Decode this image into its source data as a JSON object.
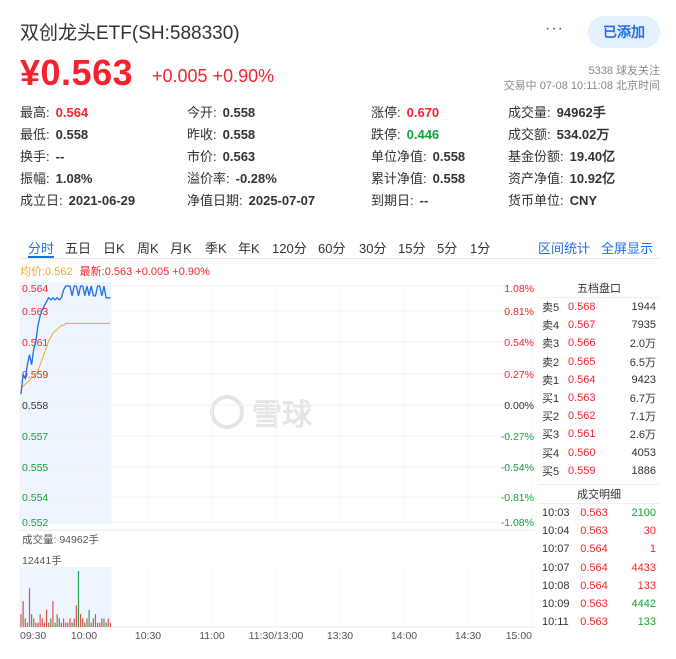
{
  "header": {
    "title": "双创龙头ETF(SH:588330)",
    "more_label": "···",
    "add_label": "已添加",
    "price": "¥0.563",
    "change": "+0.005 +0.90%",
    "followers": "5338 球友关注",
    "status": "交易中 07-08 10:11:08 北京时间"
  },
  "stats": [
    [
      {
        "label": "最高:",
        "value": "0.564",
        "color": "red"
      },
      {
        "label": "今开:",
        "value": "0.558"
      },
      {
        "label": "涨停:",
        "value": "0.670",
        "color": "red"
      },
      {
        "label": "成交量:",
        "value": "94962手"
      }
    ],
    [
      {
        "label": "最低:",
        "value": "0.558"
      },
      {
        "label": "昨收:",
        "value": "0.558"
      },
      {
        "label": "跌停:",
        "value": "0.446",
        "color": "green"
      },
      {
        "label": "成交额:",
        "value": "534.02万"
      }
    ],
    [
      {
        "label": "换手:",
        "value": "--"
      },
      {
        "label": "市价:",
        "value": "0.563"
      },
      {
        "label": "单位净值:",
        "value": "0.558"
      },
      {
        "label": "基金份额:",
        "value": "19.40亿"
      }
    ],
    [
      {
        "label": "振幅:",
        "value": "1.08%"
      },
      {
        "label": "溢价率:",
        "value": "-0.28%"
      },
      {
        "label": "累计净值:",
        "value": "0.558"
      },
      {
        "label": "资产净值:",
        "value": "10.92亿"
      }
    ],
    [
      {
        "label": "成立日:",
        "value": "2021-06-29"
      },
      {
        "label": "净值日期:",
        "value": "2025-07-07"
      },
      {
        "label": "到期日:",
        "value": "--"
      },
      {
        "label": "货币单位:",
        "value": "CNY"
      }
    ]
  ],
  "tabs": [
    "分时",
    "五日",
    "日K",
    "周K",
    "月K",
    "季K",
    "年K",
    "120分",
    "60分",
    "30分",
    "15分",
    "5分",
    "1分"
  ],
  "tab_links": [
    "区间统计",
    "全屏显示"
  ],
  "legend": {
    "avg": "均价:0.562",
    "last": "最新:0.563 +0.005 +0.90%"
  },
  "watermark": "雪球",
  "chart_data": {
    "type": "line",
    "price_axis": [
      "0.564",
      "0.563",
      "0.561",
      "0.559",
      "0.558",
      "0.557",
      "0.555",
      "0.554",
      "0.552"
    ],
    "pct_axis": [
      "1.08%",
      "0.81%",
      "0.54%",
      "0.27%",
      "0.00%",
      "-0.27%",
      "-0.54%",
      "-0.81%",
      "-1.08%"
    ],
    "ylim": [
      0.552,
      0.564
    ],
    "time_labels": [
      "09:30",
      "10:00",
      "10:30",
      "11:00",
      "11:30/13:00",
      "13:30",
      "14:00",
      "14:30",
      "15:00"
    ],
    "price_series": [
      0.5585,
      0.5595,
      0.5593,
      0.56,
      0.5605,
      0.56,
      0.5608,
      0.5612,
      0.562,
      0.5625,
      0.5628,
      0.563,
      0.5632,
      0.5634,
      0.5633,
      0.5634,
      0.5633,
      0.5634,
      0.5633,
      0.5634,
      0.5638,
      0.564,
      0.564,
      0.564,
      0.5635,
      0.564,
      0.564,
      0.5635,
      0.564,
      0.564,
      0.5635,
      0.564,
      0.5635,
      0.564,
      0.5635,
      0.5635,
      0.564,
      0.564,
      0.5635,
      0.564,
      0.5634,
      0.5634,
      0.5634
    ],
    "avg_series": [
      0.5588,
      0.5589,
      0.559,
      0.5591,
      0.5592,
      0.5593,
      0.5594,
      0.5595,
      0.5597,
      0.56,
      0.5603,
      0.5606,
      0.5609,
      0.5612,
      0.5614,
      0.5616,
      0.5617,
      0.5618,
      0.5619,
      0.562,
      0.562,
      0.5621,
      0.5621,
      0.5621,
      0.5621,
      0.5621,
      0.5621,
      0.5621,
      0.5621,
      0.5621,
      0.5621,
      0.5621,
      0.5621,
      0.5621,
      0.5621,
      0.5621,
      0.5621,
      0.5621,
      0.5621,
      0.5621,
      0.5621,
      0.5621,
      0.5621
    ],
    "volume_label": "成交量: 94962手",
    "volume_max_label": "12441手",
    "volume_series": [
      3,
      6,
      2,
      1,
      9,
      3,
      2,
      1,
      1,
      3,
      2,
      1,
      4,
      1,
      2,
      6,
      1,
      3,
      2,
      1,
      2,
      1,
      1,
      2,
      1,
      2,
      5,
      13,
      3,
      2,
      1,
      2,
      4,
      1,
      2,
      3,
      1,
      1,
      2,
      2,
      1,
      2,
      1
    ]
  },
  "order_book": {
    "title": "五档盘口",
    "rows": [
      {
        "label": "卖5",
        "price": "0.568",
        "vol": "1944"
      },
      {
        "label": "卖4",
        "price": "0.567",
        "vol": "7935"
      },
      {
        "label": "卖3",
        "price": "0.566",
        "vol": "2.0万"
      },
      {
        "label": "卖2",
        "price": "0.565",
        "vol": "6.5万"
      },
      {
        "label": "卖1",
        "price": "0.564",
        "vol": "9423"
      },
      {
        "label": "买1",
        "price": "0.563",
        "vol": "6.7万"
      },
      {
        "label": "买2",
        "price": "0.562",
        "vol": "7.1万"
      },
      {
        "label": "买3",
        "price": "0.561",
        "vol": "2.6万"
      },
      {
        "label": "买4",
        "price": "0.560",
        "vol": "4053"
      },
      {
        "label": "买5",
        "price": "0.559",
        "vol": "1886"
      }
    ]
  },
  "trades": {
    "title": "成交明细",
    "rows": [
      {
        "time": "10:03",
        "price": "0.563",
        "vol": "2100",
        "side": "buy"
      },
      {
        "time": "10:04",
        "price": "0.563",
        "vol": "30",
        "side": "sell"
      },
      {
        "time": "10:07",
        "price": "0.564",
        "vol": "1",
        "side": "sell"
      },
      {
        "time": "10:07",
        "price": "0.564",
        "vol": "4433",
        "side": "sell"
      },
      {
        "time": "10:08",
        "price": "0.564",
        "vol": "133",
        "side": "sell"
      },
      {
        "time": "10:09",
        "price": "0.563",
        "vol": "4442",
        "side": "buy"
      },
      {
        "time": "10:11",
        "price": "0.563",
        "vol": "133",
        "side": "buy"
      }
    ]
  }
}
